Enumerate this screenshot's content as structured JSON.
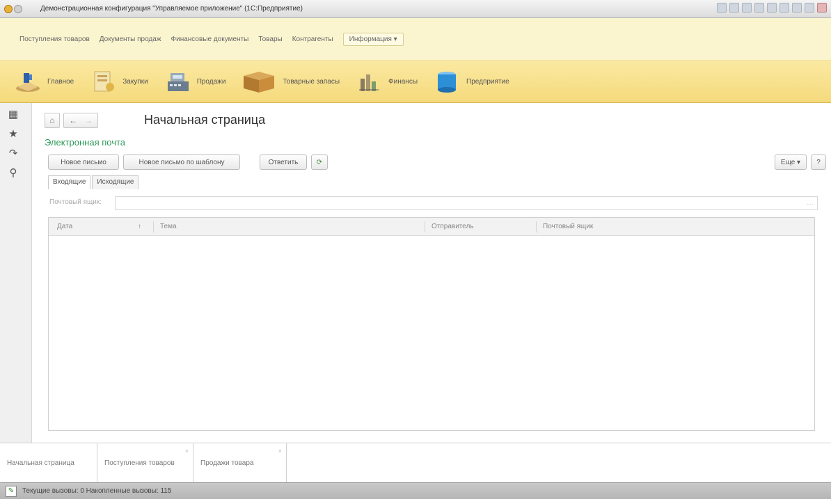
{
  "window": {
    "title": "Демонстрационная конфигурация \"Управляемое приложение\" (1С:Предприятие)"
  },
  "menu": {
    "items": [
      "Поступления товаров",
      "Документы продаж",
      "Финансовые документы",
      "Товары",
      "Контрагенты"
    ],
    "dropdown_label": "Информация ▾"
  },
  "sections": [
    {
      "label": "Главное",
      "icon": "home-icon"
    },
    {
      "label": "Закупки",
      "icon": "purchases-icon"
    },
    {
      "label": "Продажи",
      "icon": "cash-register-icon"
    },
    {
      "label": "Товарные запасы",
      "icon": "box-icon"
    },
    {
      "label": "Финансы",
      "icon": "finance-icon"
    },
    {
      "label": "Предприятие",
      "icon": "enterprise-icon"
    }
  ],
  "leftbar": {
    "icons": [
      "grid-icon",
      "star-icon",
      "history-icon",
      "search-icon"
    ]
  },
  "page": {
    "title": "Начальная страница",
    "group_title": "Электронная почта"
  },
  "toolbar": {
    "new_letter": "Новое письмо",
    "new_from_template": "Новое письмо по шаблону",
    "reply": "Ответить",
    "refresh_icon": "refresh-icon",
    "more": "Еще ▾",
    "help": "?"
  },
  "tabs": [
    "Входящие",
    "Исходящие"
  ],
  "mailbox": {
    "label": "Почтовый ящик:",
    "value": ""
  },
  "grid": {
    "columns": [
      "Дата",
      "↑",
      "Тема",
      "Отправитель",
      "Почтовый ящик"
    ],
    "rows": []
  },
  "open_windows": [
    {
      "label": "Начальная страница"
    },
    {
      "label": "Поступления товаров"
    },
    {
      "label": "Продажи товара"
    }
  ],
  "status": {
    "text": "Текущие вызовы: 0   Накопленные вызовы: 115"
  }
}
